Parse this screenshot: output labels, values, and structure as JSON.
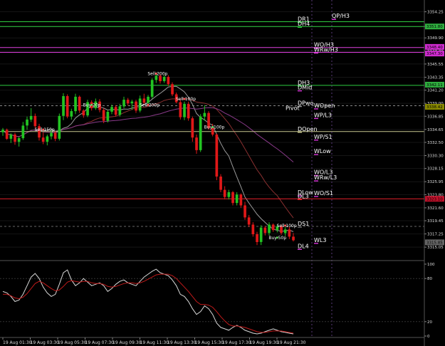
{
  "chart_data": {
    "type": "candlestick",
    "symbol_note": "",
    "price_axis": {
      "ticks": [
        3354.25,
        3351.8,
        3349.9,
        3347.7,
        3345.55,
        3343.35,
        3341.2,
        3339.0,
        3336.85,
        3334.65,
        3332.5,
        3330.3,
        3328.15,
        3325.95,
        3323.8,
        3321.6,
        3319.45,
        3317.25,
        3315.05
      ],
      "range": [
        3314.0,
        3355.5
      ]
    },
    "oscillator_axis": {
      "ticks": [
        "100",
        "80",
        "20",
        "0"
      ],
      "range": [
        0,
        100
      ]
    },
    "time_labels": [
      "19 Aug 01:30",
      "19 Aug 03:30",
      "19 Aug 05:30",
      "19 Aug 07:30",
      "19 Aug 09:30",
      "19 Aug 11:30",
      "19 Aug 13:30",
      "19 Aug 15:30",
      "19 Aug 17:30",
      "19 Aug 19:30",
      "19 Aug 21:30"
    ],
    "price_tags": [
      {
        "value": "3351.80",
        "color": "#2fae3f"
      },
      {
        "value": "3348.40",
        "color": "#d02bd0"
      },
      {
        "value": "3347.30",
        "color": "#d02bd0"
      },
      {
        "value": "3342.11",
        "color": "#2fae3f"
      },
      {
        "value": "3338.42",
        "color": "#8a8a00"
      },
      {
        "value": "3323.10",
        "color": "#c0102a"
      },
      {
        "value": "3315.85",
        "color": "#666666"
      }
    ],
    "levels": [
      {
        "label": "DR1",
        "price": 3352.6,
        "color": "#2ecc40",
        "style": "solid"
      },
      {
        "label": "DH4",
        "price": 3351.8,
        "color": "#2ecc40",
        "style": "solid"
      },
      {
        "label": "QP/H3",
        "price": 3353.1,
        "color": "#ffffff",
        "style": "none"
      },
      {
        "label": "WO/H3",
        "price": 3348.3,
        "color": "#e040e0",
        "style": "solid"
      },
      {
        "label": "WRw/H3",
        "price": 3347.5,
        "color": "#e040e0",
        "style": "solid"
      },
      {
        "label": "DH3",
        "price": 3342.0,
        "color": "#2ecc40",
        "style": "solid"
      },
      {
        "label": "DMid",
        "price": 3341.2,
        "color": "#ffffff",
        "style": "none"
      },
      {
        "label": "DPwo",
        "price": 3338.6,
        "color": "#888888",
        "style": "dash"
      },
      {
        "label": "WOpen",
        "price": 3338.2,
        "color": "#ffffff",
        "style": "none"
      },
      {
        "label": "Pivot",
        "price": 3337.8,
        "color": "#ffffff",
        "style": "none"
      },
      {
        "label": "WP/L3",
        "price": 3336.6,
        "color": "#ffffff",
        "style": "none"
      },
      {
        "label": "DOpen",
        "price": 3334.3,
        "color": "#c8c890",
        "style": "solid"
      },
      {
        "label": "WP/S1",
        "price": 3333.0,
        "color": "#ffffff",
        "style": "none"
      },
      {
        "label": "WLow",
        "price": 3330.6,
        "color": "#ffffff",
        "style": "none"
      },
      {
        "label": "WO/L3",
        "price": 3327.1,
        "color": "#ffffff",
        "style": "none"
      },
      {
        "label": "WRw/L3",
        "price": 3326.2,
        "color": "#ffffff",
        "style": "none"
      },
      {
        "label": "DLow",
        "price": 3323.7,
        "color": "#ffffff",
        "style": "none"
      },
      {
        "label": "WO/S1",
        "price": 3323.6,
        "color": "#ffffff",
        "style": "none"
      },
      {
        "label": "DL3",
        "price": 3323.1,
        "color": "#e8202a",
        "style": "solid"
      },
      {
        "label": "DS1",
        "price": 3318.5,
        "color": "#666666",
        "style": "dash"
      },
      {
        "label": "WL3",
        "price": 3315.8,
        "color": "#ffffff",
        "style": "none"
      },
      {
        "label": "DL4",
        "price": 3314.8,
        "color": "#ffffff",
        "style": "none"
      }
    ],
    "trade_labels": [
      "Sell 200p",
      "Sell 100p",
      "Sell 200p",
      "Sell 100p",
      "Buy 20p",
      "Sell 150p",
      "Buy 100p",
      "Buy 50p"
    ],
    "candles": [
      [
        3334.2,
        3334.9,
        3333.6,
        3334.6
      ],
      [
        3334.6,
        3334.8,
        3332.9,
        3333.1
      ],
      [
        3333.1,
        3334.0,
        3332.4,
        3333.8
      ],
      [
        3333.8,
        3334.1,
        3332.1,
        3332.6
      ],
      [
        3332.6,
        3333.4,
        3331.8,
        3333.2
      ],
      [
        3333.2,
        3335.9,
        3332.9,
        3335.3
      ],
      [
        3335.3,
        3336.8,
        3334.6,
        3336.3
      ],
      [
        3336.3,
        3338.2,
        3335.9,
        3336.9
      ],
      [
        3336.9,
        3337.3,
        3334.9,
        3335.2
      ],
      [
        3335.2,
        3335.6,
        3332.8,
        3333.3
      ],
      [
        3333.3,
        3334.2,
        3332.2,
        3332.6
      ],
      [
        3332.6,
        3333.8,
        3332.0,
        3333.5
      ],
      [
        3333.5,
        3334.6,
        3333.0,
        3334.1
      ],
      [
        3334.1,
        3334.4,
        3332.7,
        3333.1
      ],
      [
        3333.1,
        3337.3,
        3332.8,
        3336.9
      ],
      [
        3336.9,
        3340.7,
        3336.2,
        3340.2
      ],
      [
        3340.2,
        3340.5,
        3336.5,
        3336.8
      ],
      [
        3336.8,
        3338.1,
        3336.3,
        3337.7
      ],
      [
        3337.7,
        3340.6,
        3337.2,
        3340.1
      ],
      [
        3340.1,
        3340.3,
        3337.4,
        3337.8
      ],
      [
        3337.8,
        3338.0,
        3336.6,
        3337.0
      ],
      [
        3337.0,
        3339.6,
        3336.7,
        3339.2
      ],
      [
        3339.2,
        3339.5,
        3337.8,
        3338.2
      ],
      [
        3338.2,
        3339.8,
        3337.9,
        3339.3
      ],
      [
        3339.3,
        3339.7,
        3337.5,
        3337.9
      ],
      [
        3337.9,
        3338.2,
        3335.7,
        3336.1
      ],
      [
        3336.1,
        3337.9,
        3335.8,
        3337.6
      ],
      [
        3337.6,
        3338.8,
        3337.2,
        3338.4
      ],
      [
        3338.4,
        3338.7,
        3336.8,
        3337.1
      ],
      [
        3337.1,
        3338.9,
        3336.8,
        3338.5
      ],
      [
        3338.5,
        3340.1,
        3338.2,
        3339.6
      ],
      [
        3339.6,
        3339.9,
        3338.6,
        3339.0
      ],
      [
        3339.0,
        3339.6,
        3337.9,
        3339.3
      ],
      [
        3339.3,
        3339.6,
        3337.4,
        3337.8
      ],
      [
        3337.8,
        3340.3,
        3337.5,
        3339.8
      ],
      [
        3339.8,
        3340.6,
        3338.8,
        3339.1
      ],
      [
        3339.1,
        3340.4,
        3338.8,
        3340.1
      ],
      [
        3340.1,
        3343.2,
        3339.8,
        3342.9
      ],
      [
        3342.9,
        3344.0,
        3342.4,
        3343.6
      ],
      [
        3343.6,
        3343.9,
        3342.3,
        3342.7
      ],
      [
        3342.7,
        3343.7,
        3342.4,
        3343.4
      ],
      [
        3343.4,
        3343.7,
        3341.9,
        3342.2
      ],
      [
        3342.2,
        3342.5,
        3340.2,
        3340.5
      ],
      [
        3340.5,
        3340.8,
        3339.0,
        3339.2
      ],
      [
        3339.2,
        3339.5,
        3336.3,
        3336.7
      ],
      [
        3336.7,
        3339.3,
        3336.2,
        3338.9
      ],
      [
        3338.9,
        3339.3,
        3336.1,
        3336.5
      ],
      [
        3336.5,
        3336.8,
        3332.6,
        3333.3
      ],
      [
        3333.3,
        3333.8,
        3330.6,
        3331.2
      ],
      [
        3331.2,
        3337.2,
        3330.9,
        3336.8
      ],
      [
        3336.8,
        3338.7,
        3336.1,
        3337.4
      ],
      [
        3337.4,
        3337.7,
        3334.6,
        3334.9
      ],
      [
        3334.9,
        3335.6,
        3333.5,
        3333.8
      ],
      [
        3333.8,
        3334.0,
        3326.2,
        3326.8
      ],
      [
        3326.8,
        3327.2,
        3324.2,
        3324.6
      ],
      [
        3324.6,
        3325.2,
        3323.0,
        3323.4
      ],
      [
        3323.4,
        3324.6,
        3323.0,
        3324.2
      ],
      [
        3324.2,
        3324.4,
        3322.0,
        3322.4
      ],
      [
        3322.4,
        3324.2,
        3322.0,
        3323.8
      ],
      [
        3323.8,
        3324.0,
        3321.6,
        3322.0
      ],
      [
        3322.0,
        3322.6,
        3319.6,
        3320.0
      ],
      [
        3320.0,
        3320.4,
        3318.4,
        3318.8
      ],
      [
        3318.8,
        3319.2,
        3316.8,
        3317.2
      ],
      [
        3317.2,
        3317.6,
        3315.4,
        3315.9
      ],
      [
        3315.9,
        3318.7,
        3315.4,
        3318.3
      ],
      [
        3318.3,
        3318.6,
        3317.0,
        3317.4
      ],
      [
        3317.4,
        3319.2,
        3317.0,
        3318.8
      ],
      [
        3318.8,
        3319.0,
        3317.6,
        3317.9
      ],
      [
        3317.9,
        3318.8,
        3317.5,
        3318.5
      ],
      [
        3318.5,
        3318.8,
        3317.1,
        3317.4
      ],
      [
        3317.4,
        3318.4,
        3316.9,
        3318.0
      ],
      [
        3318.0,
        3318.4,
        3316.4,
        3316.8
      ],
      [
        3316.8,
        3317.4,
        3316.0,
        3316.2
      ]
    ],
    "oscillator_main": [
      62,
      60,
      55,
      48,
      50,
      58,
      70,
      82,
      87,
      80,
      68,
      60,
      55,
      58,
      72,
      88,
      92,
      78,
      70,
      74,
      80,
      75,
      70,
      72,
      74,
      70,
      62,
      66,
      72,
      76,
      78,
      74,
      72,
      70,
      76,
      82,
      86,
      90,
      93,
      88,
      86,
      84,
      78,
      70,
      58,
      55,
      48,
      38,
      30,
      34,
      42,
      38,
      30,
      18,
      12,
      10,
      8,
      12,
      15,
      12,
      8,
      6,
      4,
      3,
      4,
      6,
      8,
      10,
      8,
      6,
      5,
      4,
      3
    ],
    "oscillator_signal": [
      58,
      58,
      56,
      53,
      52,
      54,
      59,
      66,
      73,
      76,
      74,
      70,
      66,
      63,
      64,
      69,
      75,
      77,
      76,
      75,
      76,
      76,
      74,
      73,
      73,
      72,
      69,
      68,
      69,
      71,
      73,
      74,
      74,
      73,
      74,
      76,
      79,
      82,
      85,
      86,
      86,
      86,
      84,
      80,
      74,
      68,
      62,
      55,
      48,
      44,
      44,
      43,
      40,
      34,
      27,
      21,
      16,
      14,
      14,
      13,
      12,
      10,
      8,
      6,
      5,
      5,
      6,
      7,
      7,
      7,
      6,
      5,
      4
    ]
  }
}
